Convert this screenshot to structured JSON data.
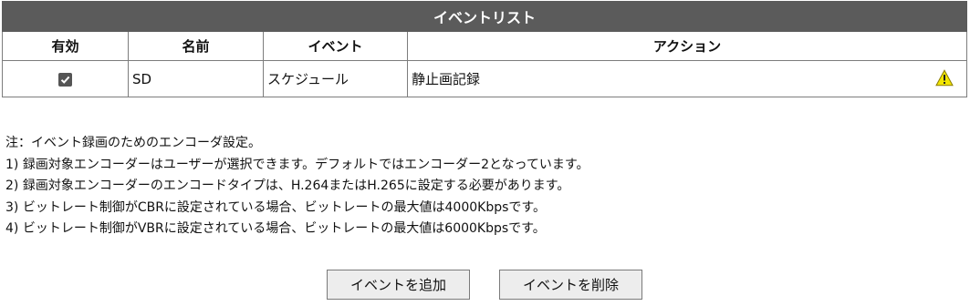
{
  "table": {
    "title": "イベントリスト",
    "headers": {
      "enabled": "有効",
      "name": "名前",
      "event": "イベント",
      "action": "アクション"
    },
    "rows": [
      {
        "enabled": true,
        "name": "SD",
        "event": "スケジュール",
        "action": "静止画記録",
        "icon": "warning-icon"
      }
    ]
  },
  "notes": {
    "heading": "注：イベント録画のためのエンコーダ設定。",
    "items": [
      "1) 録画対象エンコーダーはユーザーが選択できます。デフォルトではエンコーダー2となっています。",
      "2) 録画対象エンコーダーのエンコードタイプは、H.264またはH.265に設定する必要があります。",
      "3) ビットレート制御がCBRに設定されている場合、ビットレートの最大値は4000Kbpsです。",
      "4) ビットレート制御がVBRに設定されている場合、ビットレートの最大値は6000Kbpsです。"
    ]
  },
  "buttons": {
    "add_label": "イベントを追加",
    "delete_label": "イベントを削除"
  },
  "colors": {
    "header_bg": "#5b5b5b",
    "checkbox": "#555555",
    "warning_fill": "#f2e600"
  }
}
